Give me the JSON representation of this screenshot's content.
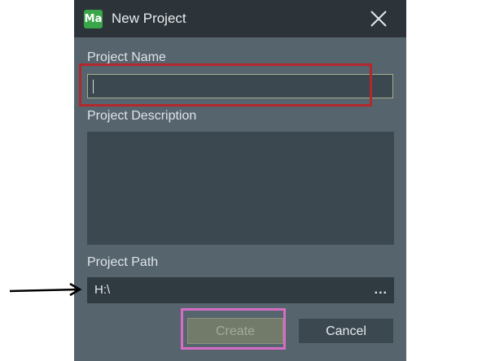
{
  "dialog": {
    "app_logo_text": "Ma",
    "title": "New Project",
    "close_icon": "close-icon"
  },
  "form": {
    "name_label": "Project Name",
    "name_value": "",
    "description_label": "Project Description",
    "description_value": "",
    "path_label": "Project Path",
    "path_value": "H:\\",
    "browse_label": "..."
  },
  "buttons": {
    "create_label": "Create",
    "cancel_label": "Cancel"
  },
  "annotations": {
    "highlight_name_color": "#b3282c",
    "highlight_create_color": "#d76cc4",
    "arrow_icon": "arrow-right-icon"
  }
}
